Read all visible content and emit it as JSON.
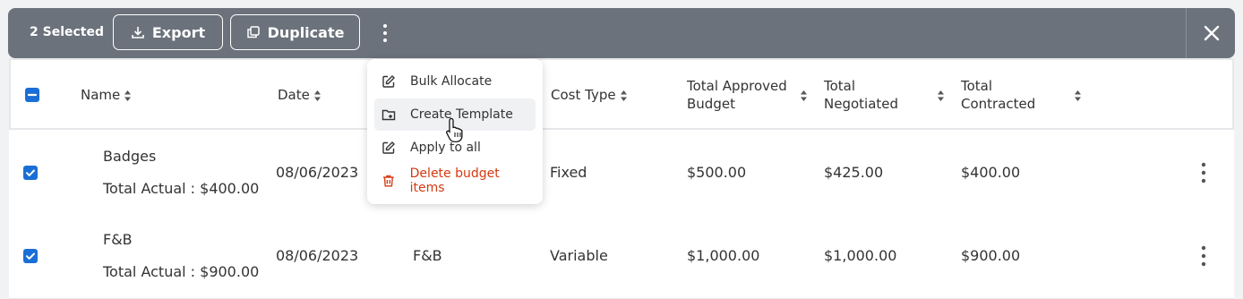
{
  "toolbar": {
    "selected_label": "2 Selected",
    "export_label": "Export",
    "duplicate_label": "Duplicate",
    "background": "#6b727c"
  },
  "table": {
    "headers": {
      "name": "Name",
      "date": "Date",
      "cost_type": "Cost Type",
      "approved_line1": "Total Approved",
      "approved_line2": "Budget",
      "negotiated_line1": "Total",
      "negotiated_line2": "Negotiated",
      "contracted_line1": "Total",
      "contracted_line2": "Contracted"
    },
    "rows": [
      {
        "name": "Badges",
        "actual": "Total Actual : $400.00",
        "date": "08/06/2023",
        "category": "",
        "cost_type": "Fixed",
        "approved": "$500.00",
        "negotiated": "$425.00",
        "contracted": "$400.00",
        "checked": true
      },
      {
        "name": "F&B",
        "actual": "Total Actual : $900.00",
        "date": "08/06/2023",
        "category": "F&B",
        "cost_type": "Variable",
        "approved": "$1,000.00",
        "negotiated": "$1,000.00",
        "contracted": "$900.00",
        "checked": true
      }
    ]
  },
  "menu": {
    "items": [
      {
        "label": "Bulk Allocate",
        "icon": "edit-icon"
      },
      {
        "label": "Create Template",
        "icon": "folder-add-icon",
        "highlighted": true
      },
      {
        "label": "Apply to all",
        "icon": "edit-icon"
      },
      {
        "label": "Delete budget items",
        "icon": "trash-icon",
        "danger": true
      }
    ]
  },
  "colors": {
    "accent": "#1a6fd6",
    "danger": "#d33a12"
  }
}
